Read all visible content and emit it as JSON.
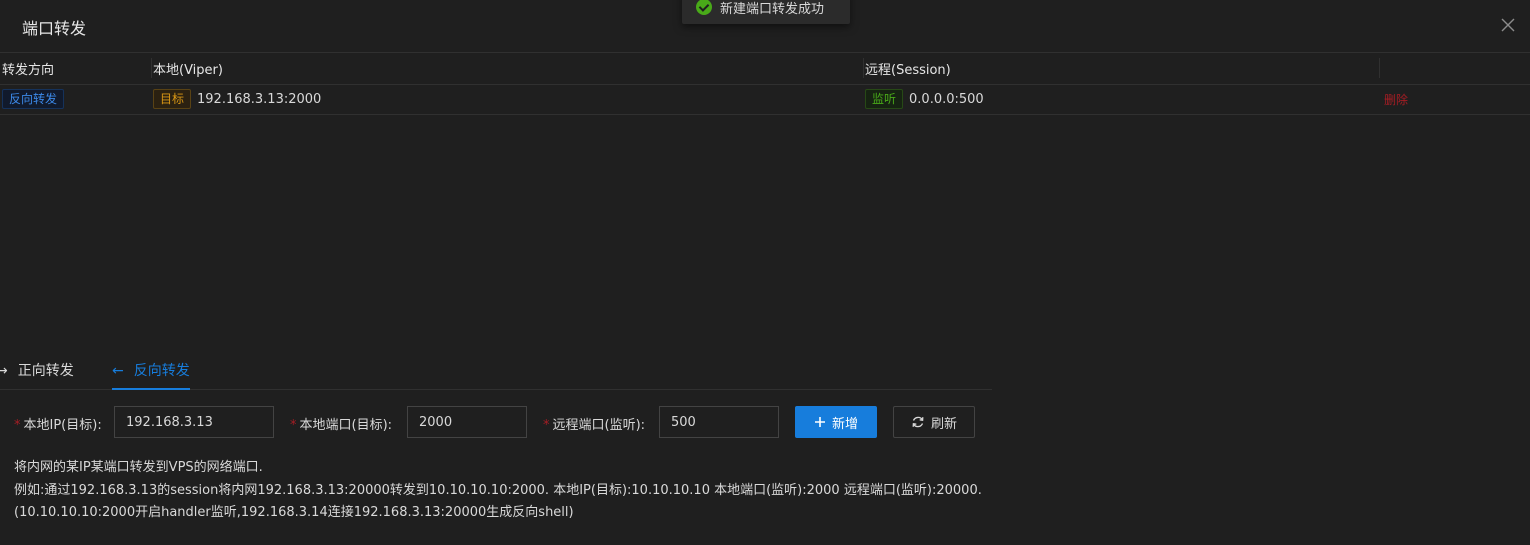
{
  "dialog": {
    "title": "端口转发",
    "close_icon": "close-icon"
  },
  "toast": {
    "message": "新建端口转发成功",
    "icon": "check-circle-icon",
    "color": "#49aa19"
  },
  "table": {
    "columns": [
      "转发方向",
      "本地(Viper)",
      "远程(Session)",
      ""
    ],
    "rows": [
      {
        "direction_tag": "反向转发",
        "local_tag": "目标",
        "local_addr": "192.168.3.13:2000",
        "remote_tag": "监听",
        "remote_addr": "0.0.0.0:500",
        "action": "删除"
      }
    ]
  },
  "tabs": [
    {
      "arrow": "→",
      "label": "正向转发",
      "active": false
    },
    {
      "arrow": "←",
      "label": "反向转发",
      "active": true
    }
  ],
  "form": {
    "local_ip_label": "本地IP(目标):",
    "local_ip_value": "192.168.3.13",
    "local_port_label": "本地端口(目标):",
    "local_port_value": "2000",
    "remote_port_label": "远程端口(监听):",
    "remote_port_value": "500",
    "add_label": "新增",
    "refresh_label": "刷新",
    "required_mark": "*"
  },
  "description": {
    "line1": "将内网的某IP某端口转发到VPS的网络端口.",
    "line2": "例如:通过192.168.3.13的session将内网192.168.3.13:20000转发到10.10.10.10:2000. 本地IP(目标):10.10.10.10 本地端口(监听):2000 远程端口(监听):20000.",
    "line3": "(10.10.10.10:2000开启handler监听,192.168.3.14连接192.168.3.13:20000生成反向shell)"
  },
  "colors": {
    "accent": "#177ddc",
    "danger": "#a61d24",
    "background": "#1f1f1f"
  }
}
